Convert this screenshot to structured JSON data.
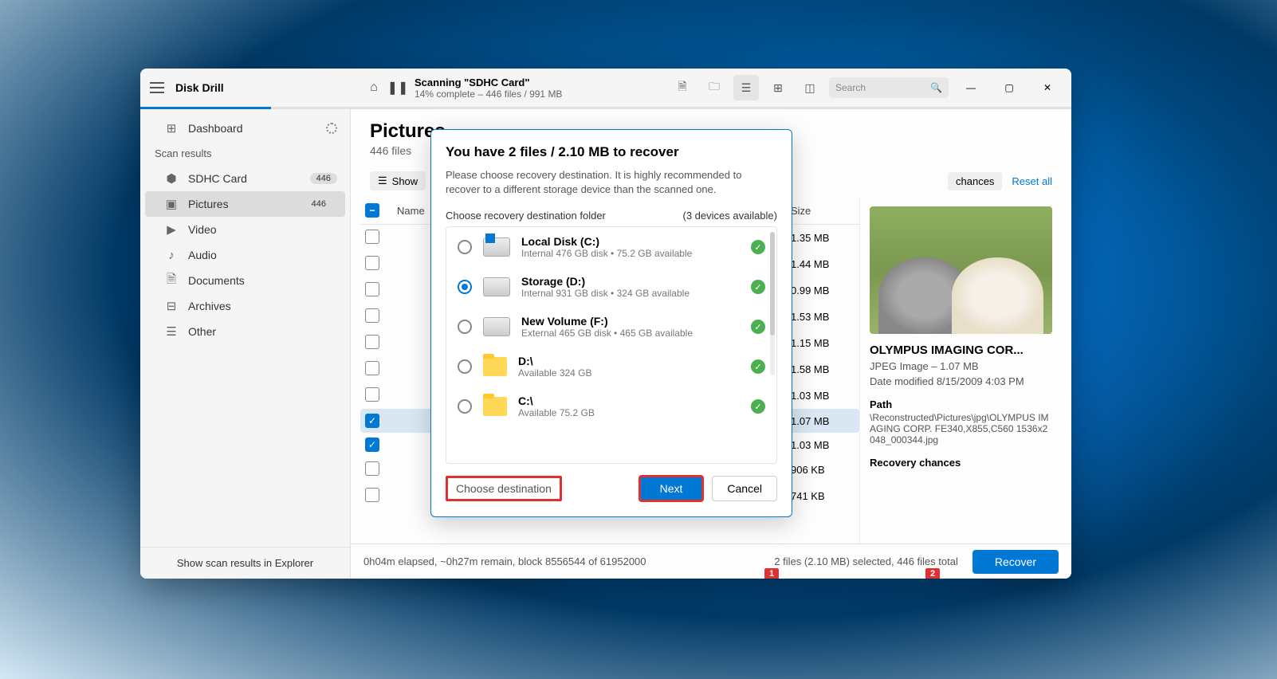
{
  "app": {
    "name": "Disk Drill"
  },
  "scan": {
    "title": "Scanning \"SDHC Card\"",
    "subtitle": "14% complete – 446 files / 991 MB"
  },
  "search": {
    "placeholder": "Search"
  },
  "sidebar": {
    "dashboard": "Dashboard",
    "header": "Scan results",
    "items": [
      {
        "icon": "disk",
        "label": "SDHC Card",
        "badge": "446"
      },
      {
        "icon": "image",
        "label": "Pictures",
        "badge": "446",
        "active": true
      },
      {
        "icon": "video",
        "label": "Video"
      },
      {
        "icon": "audio",
        "label": "Audio"
      },
      {
        "icon": "doc",
        "label": "Documents"
      },
      {
        "icon": "archive",
        "label": "Archives"
      },
      {
        "icon": "other",
        "label": "Other"
      }
    ],
    "footer": "Show scan results in Explorer"
  },
  "page": {
    "title": "Pictures",
    "subtitle": "446 files"
  },
  "toolbar": {
    "show": "Show",
    "chances_fragment": "chances",
    "reset": "Reset all"
  },
  "table": {
    "col_name": "Name",
    "col_size": "Size",
    "rows": [
      {
        "size": "1.35 MB",
        "checked": false
      },
      {
        "size": "1.44 MB",
        "checked": false
      },
      {
        "size": "0.99 MB",
        "checked": false
      },
      {
        "size": "1.53 MB",
        "checked": false
      },
      {
        "size": "1.15 MB",
        "checked": false
      },
      {
        "size": "1.58 MB",
        "checked": false
      },
      {
        "size": "1.03 MB",
        "checked": false
      },
      {
        "size": "1.07 MB",
        "checked": true,
        "selected": true
      },
      {
        "size": "1.03 MB",
        "checked": true
      },
      {
        "size": "906 KB",
        "checked": false
      },
      {
        "size": "741 KB",
        "checked": false
      }
    ]
  },
  "preview": {
    "title": "OLYMPUS IMAGING COR...",
    "meta": "JPEG Image – 1.07 MB",
    "date": "Date modified 8/15/2009 4:03 PM",
    "path_label": "Path",
    "path": "\\Reconstructed\\Pictures\\jpg\\OLYMPUS IMAGING CORP. FE340,X855,C560 1536x2048_000344.jpg",
    "chances_label": "Recovery chances"
  },
  "status": {
    "left": "0h04m elapsed, ~0h27m remain, block 8556544 of 61952000",
    "right": "2 files (2.10 MB) selected, 446 files total",
    "recover": "Recover"
  },
  "modal": {
    "title": "You have 2 files / 2.10 MB to recover",
    "desc": "Please choose recovery destination. It is highly recommended to recover to a different storage device than the scanned one.",
    "dest_label": "Choose recovery destination folder",
    "dest_count": "(3 devices available)",
    "destinations": [
      {
        "name": "Local Disk (C:)",
        "sub": "Internal 476 GB disk • 75.2 GB available",
        "type": "win",
        "selected": false
      },
      {
        "name": "Storage (D:)",
        "sub": "Internal 931 GB disk • 324 GB available",
        "type": "drive",
        "selected": true
      },
      {
        "name": "New Volume (F:)",
        "sub": "External 465 GB disk • 465 GB available",
        "type": "drive",
        "selected": false
      },
      {
        "name": "D:\\",
        "sub": "Available 324 GB",
        "type": "folder",
        "selected": false
      },
      {
        "name": "C:\\",
        "sub": "Available 75.2 GB",
        "type": "folder",
        "selected": false
      }
    ],
    "choose": "Choose destination",
    "next": "Next",
    "cancel": "Cancel",
    "badge1": "1",
    "badge2": "2"
  }
}
